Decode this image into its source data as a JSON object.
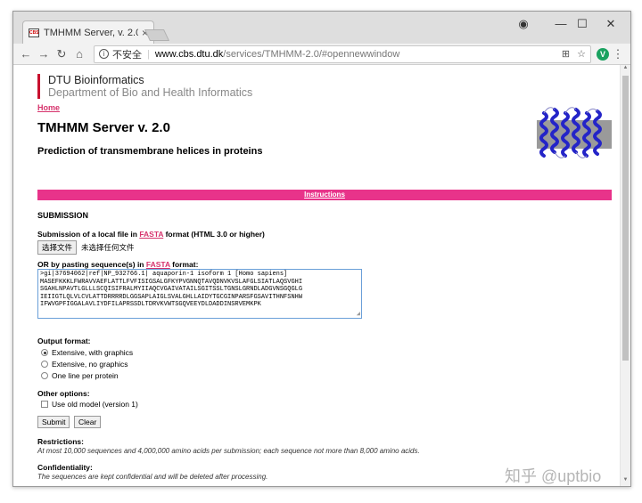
{
  "browser": {
    "tab_title": "TMHMM Server, v. 2.0",
    "tab_close": "×",
    "favicon_text": "CBS",
    "window_controls": {
      "account": "◉",
      "minimize": "—",
      "maximize": "☐",
      "close": "✕"
    },
    "url": {
      "insecure_label": "不安全",
      "host": "www.cbs.dtu.dk",
      "path": "/services/TMHMM-2.0/#opennewwindow"
    }
  },
  "header": {
    "org_name": "DTU Bioinformatics",
    "org_dept": "Department of Bio and Health Informatics",
    "home_link": "Home",
    "title": "TMHMM Server v. 2.0",
    "subtitle": "Prediction of transmembrane helices in proteins"
  },
  "instructions_link": "Instructions",
  "submission": {
    "heading": "SUBMISSION",
    "file_label_prefix": "Submission of a local file in ",
    "file_label_link": "FASTA",
    "file_label_suffix": " format (HTML 3.0 or higher)",
    "file_button": "选择文件",
    "file_status": "未选择任何文件",
    "paste_label_prefix": "OR by pasting sequence(s) in ",
    "paste_label_link": "FASTA",
    "paste_label_suffix": " format:",
    "sequence": ">gi|37694062|ref|NP_932766.1| aquaporin-1 isoform 1 [Homo sapiens]\nMASEFKKKLFWRAVVAEFLATTLFVFISIGSALGFKYPVGNNQTAVQDNVKVSLAFGLSIATLAQSVGHI\nSGAHLNPAVTLGLLLSCQISIFRALMYIIAQCVGAIVATAILSGITSSLTGNSLGRNDLADGVNSGQGLG\nIEIIGTLQLVLCVLATTDRRRRDLGGSAPLAIGLSVALGHLLAIDYTGCGINPARSFGSAVITHNFSNHW\nIFWVGPFIGGALAVLIYDFILAPRSSDLTDRVKVWTSGQVEEYDLDADDINSRVEMKPK"
  },
  "output_format": {
    "heading": "Output format:",
    "options": [
      {
        "label": "Extensive, with graphics",
        "checked": true
      },
      {
        "label": "Extensive, no graphics",
        "checked": false
      },
      {
        "label": "One line per protein",
        "checked": false
      }
    ]
  },
  "other_options": {
    "heading": "Other options:",
    "old_model_label": "Use old model (version 1)",
    "old_model_checked": false
  },
  "buttons": {
    "submit": "Submit",
    "clear": "Clear"
  },
  "restrictions": {
    "heading": "Restrictions:",
    "text": "At most 10,000 sequences and 4,000,000 amino acids per submission; each sequence not more than 8,000 amino acids."
  },
  "confidentiality": {
    "heading": "Confidentiality:",
    "text": "The sequences are kept confidential and will be deleted after processing."
  },
  "watermark": "知乎 @uptbio",
  "colors": {
    "accent_pink": "#e8338a",
    "dtu_red": "#c8102e",
    "helix_blue": "#2424c8"
  }
}
